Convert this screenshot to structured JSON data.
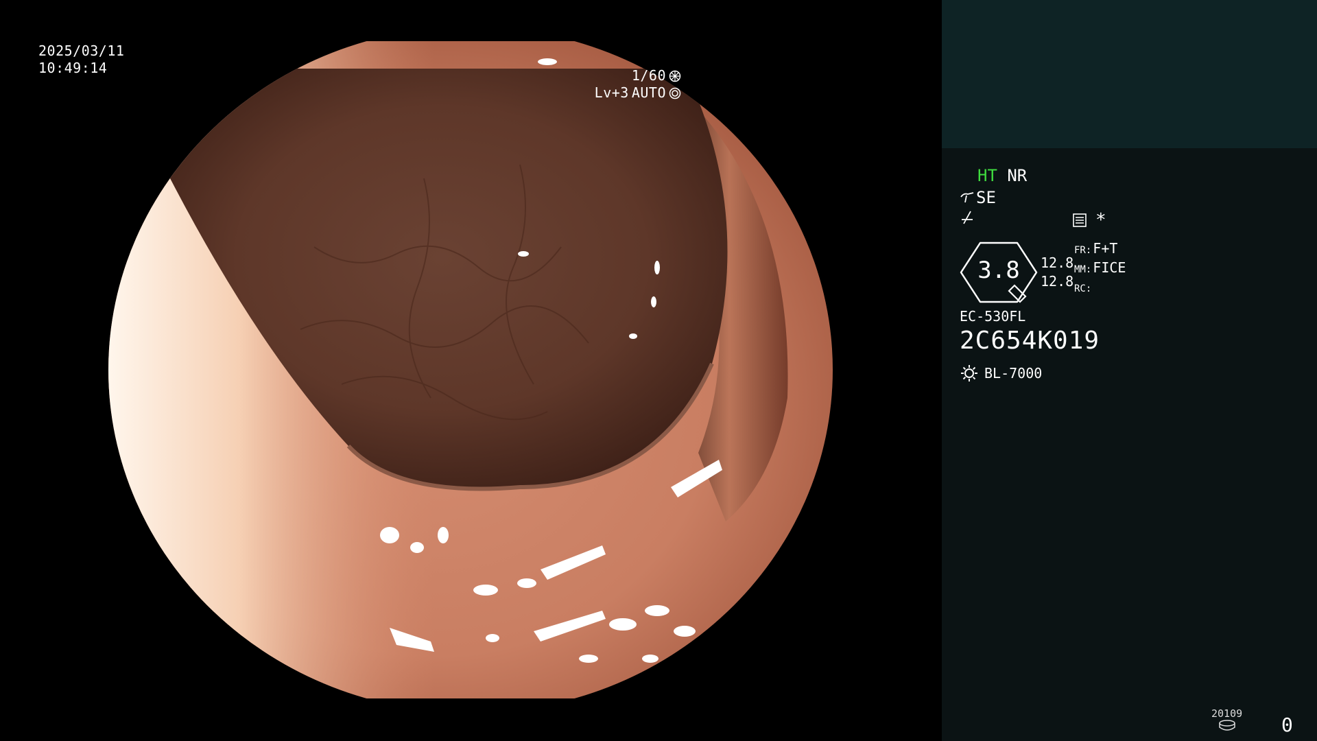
{
  "overlay": {
    "date": "2025/03/11",
    "time": "10:49:14",
    "shutter": "1/60",
    "level": "Lv+3",
    "exposure_mode": "AUTO"
  },
  "panel": {
    "ht_label": "HT",
    "nr_label": "NR",
    "se_label": "SE",
    "iris_value": "3.8",
    "num_1": "12.8",
    "num_2": "12.8",
    "fr_key": "FR:",
    "fr_value": "F+T",
    "mm_key": "MM:",
    "mm_value": "FICE",
    "rc_key": "RC:",
    "rc_value": "",
    "asterisk": "*",
    "scope_model": "EC-530FL",
    "scope_serial": "2C654K019",
    "light_source": "BL-7000",
    "record_code": "20109",
    "record_count": "0"
  },
  "icons": [
    "aperture-icon",
    "auto-exposure-icon",
    "scope-curve-icon",
    "structure-icon",
    "menu-list-icon",
    "iris-icon",
    "lamp-icon",
    "disk-icon"
  ],
  "colors": {
    "panel_top": "#0e2325",
    "panel_bg": "#0b1314",
    "ht_accent": "#3fdc3f"
  }
}
